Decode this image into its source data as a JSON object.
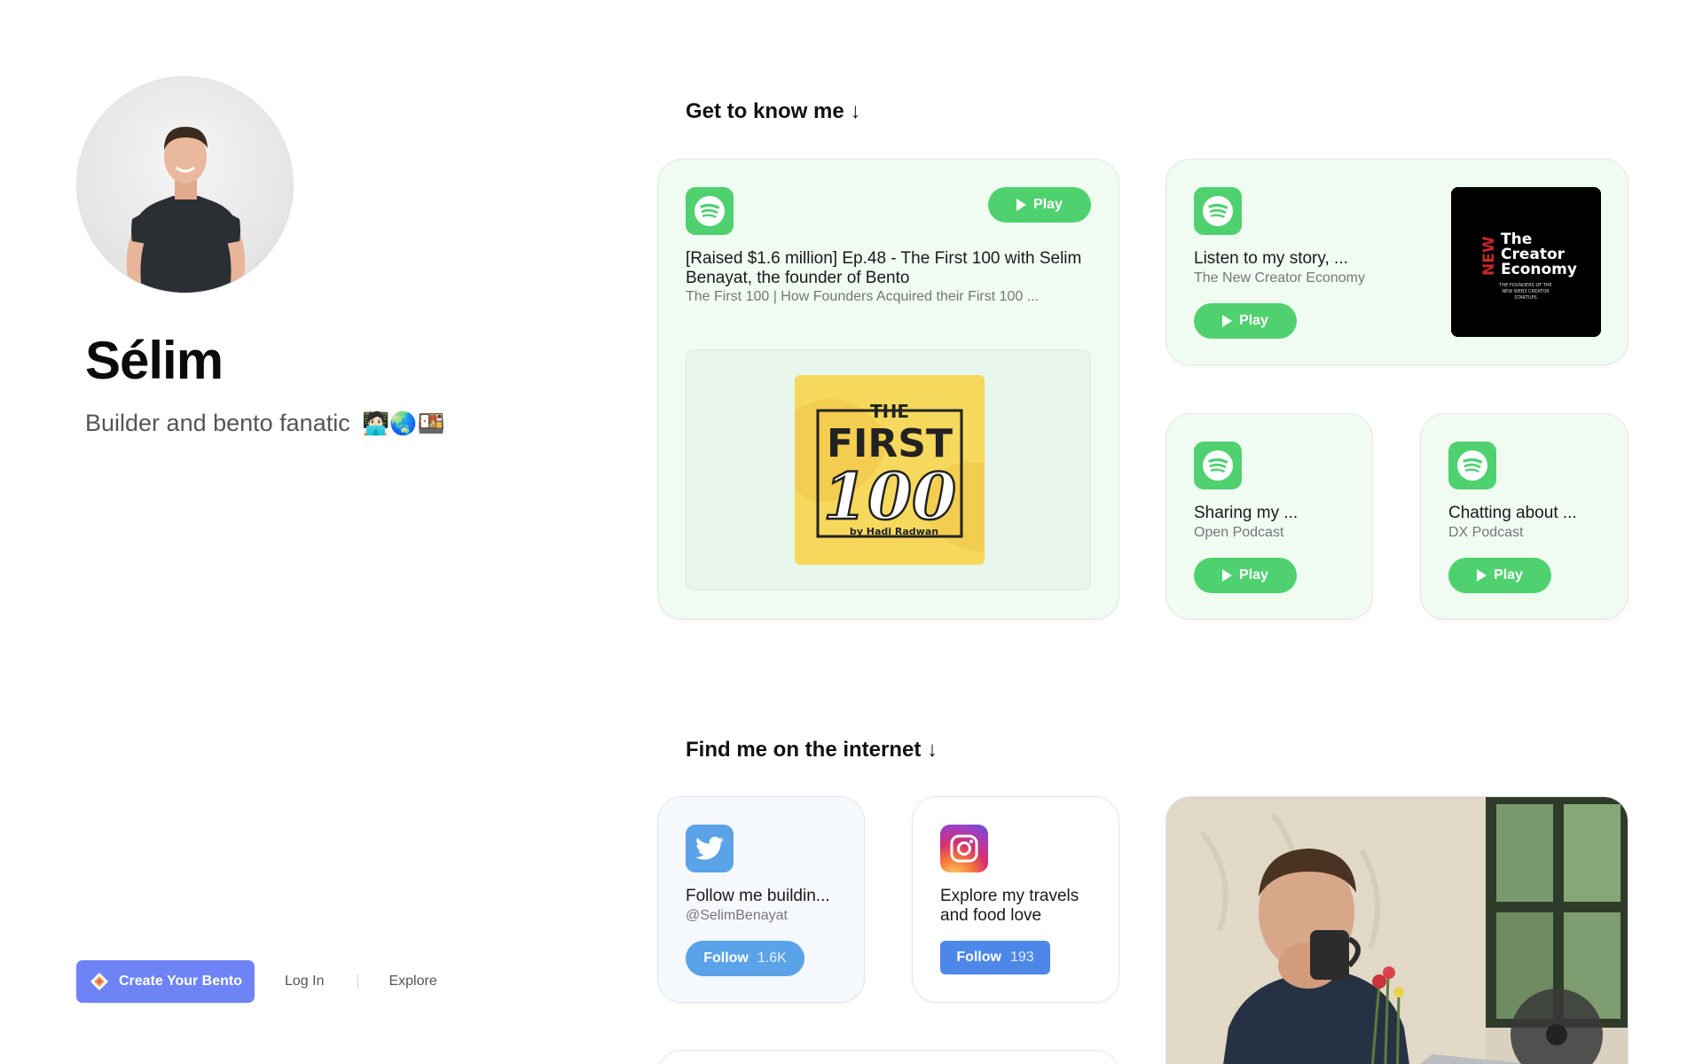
{
  "profile": {
    "name": "Sélim",
    "bio": "Builder and bento fanatic",
    "bio_emoji": "🧑🏻‍💻🌏🍱"
  },
  "footer": {
    "create_label": "Create Your Bento",
    "login_label": "Log In",
    "explore_label": "Explore"
  },
  "sections": {
    "know_me": "Get to know me ↓",
    "internet": "Find me on the internet ↓"
  },
  "cards": {
    "first100": {
      "title": "[Raised $1.6 million] Ep.48 - The First 100 with Selim Benayat, the founder of Bento",
      "subtitle": "The First 100 | How Founders Acquired their First 100 ...",
      "play_label": "Play",
      "cover_top": "THE",
      "cover_mid": "FIRST",
      "cover_num": "100",
      "cover_by": "by Hadi Radwan"
    },
    "creator": {
      "title": "Listen to my story, ...",
      "subtitle": "The New Creator Economy",
      "play_label": "Play",
      "cover_new": "NEW",
      "cover_the": "The",
      "cover_creator": "Creator",
      "cover_economy": "Economy",
      "cover_tag1": "THE FOUNDERS OF THE",
      "cover_tag2": "NEW WEB3 CREATOR",
      "cover_tag3": "STARTUPS"
    },
    "open_podcast": {
      "title": "Sharing my ...",
      "subtitle": "Open Podcast",
      "play_label": "Play"
    },
    "dx_podcast": {
      "title": "Chatting about ...",
      "subtitle": "DX Podcast",
      "play_label": "Play"
    },
    "twitter": {
      "title": "Follow me buildin...",
      "subtitle": "@SelimBenayat",
      "follow_label": "Follow",
      "follow_count": "1.6K"
    },
    "instagram": {
      "title": "Explore my travels and food love",
      "follow_label": "Follow",
      "follow_count": "193"
    }
  },
  "colors": {
    "spotify_green": "#4fd16f",
    "card_green_bg": "#f0fbf2",
    "twitter_blue": "#5aa3e8",
    "bento_purple": "#6e83f5"
  },
  "icons": [
    "spotify-icon",
    "twitter-icon",
    "instagram-icon",
    "bento-logo-icon",
    "play-icon"
  ]
}
